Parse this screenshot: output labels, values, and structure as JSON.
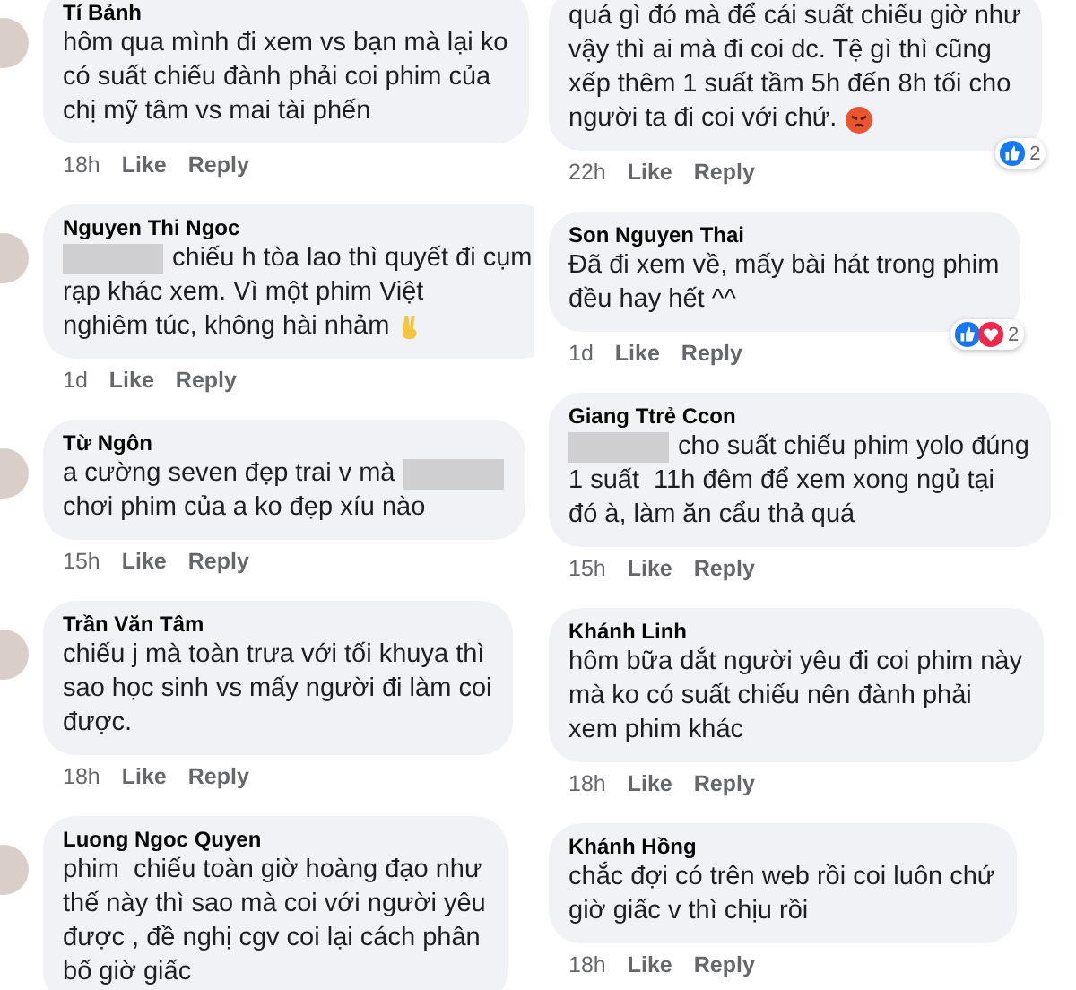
{
  "columns": [
    {
      "avatars_visible": true,
      "comments": [
        {
          "name": "Tí Bảnh",
          "body": [
            [
              {
                "kind": "text",
                "text": "hôm qua mình đi xem vs bạn mà lại ko\ncó suất chiếu đành phải coi phim của\nchị mỹ tâm vs mai tài phến"
              }
            ]
          ],
          "time": "18h",
          "actions": [
            "Like",
            "Reply"
          ]
        },
        {
          "name": "Nguyen Thi Ngoc",
          "body": [
            [
              {
                "kind": "redaction"
              },
              {
                "kind": "text",
                "text": "chiếu h tòa lao thì quyết đi cụm"
              }
            ],
            [
              {
                "kind": "text",
                "text": "rạp khác xem. Vì một phim Việt"
              }
            ],
            [
              {
                "kind": "text",
                "text": "nghiêm túc, không hài nhảm"
              },
              {
                "kind": "victory_emoji"
              }
            ]
          ],
          "time": "1d",
          "actions": [
            "Like",
            "Reply"
          ]
        },
        {
          "name": "Từ Ngôn",
          "body": [
            [
              {
                "kind": "text",
                "text": "a cường seven đẹp trai v mà"
              },
              {
                "kind": "redaction"
              }
            ],
            [
              {
                "kind": "text",
                "text": "chơi phim của a ko đẹp xíu nào"
              }
            ]
          ],
          "time": "15h",
          "actions": [
            "Like",
            "Reply"
          ]
        },
        {
          "name": "Trần Văn Tâm",
          "body": [
            [
              {
                "kind": "text",
                "text": "chiếu j mà toàn trưa với tối khuya thì\nsao học sinh vs mấy người đi làm coi\nđược."
              }
            ]
          ],
          "time": "18h",
          "actions": [
            "Like",
            "Reply"
          ]
        },
        {
          "name": "Luong Ngoc Quyen",
          "body": [
            [
              {
                "kind": "text",
                "text": "phim  chiếu toàn giờ hoàng đạo như\nthế này thì sao mà coi với người yêu\nđược , đề nghị cgv coi lại cách phân\nbố giờ giấc"
              }
            ]
          ]
        }
      ]
    },
    {
      "avatars_visible": false,
      "comments": [
        {
          "body": [
            [
              {
                "kind": "text",
                "text": "quá gì đó mà để cái suất chiếu giờ như\nvậy thì ai mà đi coi dc. Tệ gì thì cũng\nxếp thêm 1 suất tầm 5h đến 8h tối cho"
              }
            ],
            [
              {
                "kind": "text",
                "text": "người ta đi coi với chứ."
              },
              {
                "kind": "angry_emoji"
              }
            ]
          ],
          "reactions": {
            "icons": [
              {
                "kind": "like"
              }
            ],
            "count": "2"
          },
          "time": "22h",
          "actions": [
            "Like",
            "Reply"
          ]
        },
        {
          "name": "Son Nguyen Thai",
          "body": [
            [
              {
                "kind": "text",
                "text": "Đã đi xem về, mấy bài hát trong phim\nđều hay hết ^^"
              }
            ]
          ],
          "reactions": {
            "icons": [
              {
                "kind": "like"
              },
              {
                "kind": "love"
              }
            ],
            "count": "2"
          },
          "time": "1d",
          "actions": [
            "Like",
            "Reply"
          ]
        },
        {
          "name": "Giang Ttrẻ Ccon",
          "body": [
            [
              {
                "kind": "redaction"
              },
              {
                "kind": "text",
                "text": "cho suất chiếu phim yolo đúng"
              }
            ],
            [
              {
                "kind": "text",
                "text": "1 suất  11h đêm để xem xong ngủ tại\nđó à, làm ăn cẩu thả quá"
              }
            ]
          ],
          "time": "15h",
          "actions": [
            "Like",
            "Reply"
          ]
        },
        {
          "name": "Khánh Linh",
          "body": [
            [
              {
                "kind": "text",
                "text": "hôm bữa dắt người yêu đi coi phim này\nmà ko có suất chiếu nên đành phải\nxem phim khác"
              }
            ]
          ],
          "time": "18h",
          "actions": [
            "Like",
            "Reply"
          ]
        },
        {
          "name": "Khánh Hồng",
          "body": [
            [
              {
                "kind": "text",
                "text": "chắc đợi có trên web rồi coi luôn chứ\ngiờ giấc v thì chịu rồi"
              }
            ]
          ],
          "time": "18h",
          "actions": [
            "Like",
            "Reply"
          ]
        }
      ]
    }
  ]
}
